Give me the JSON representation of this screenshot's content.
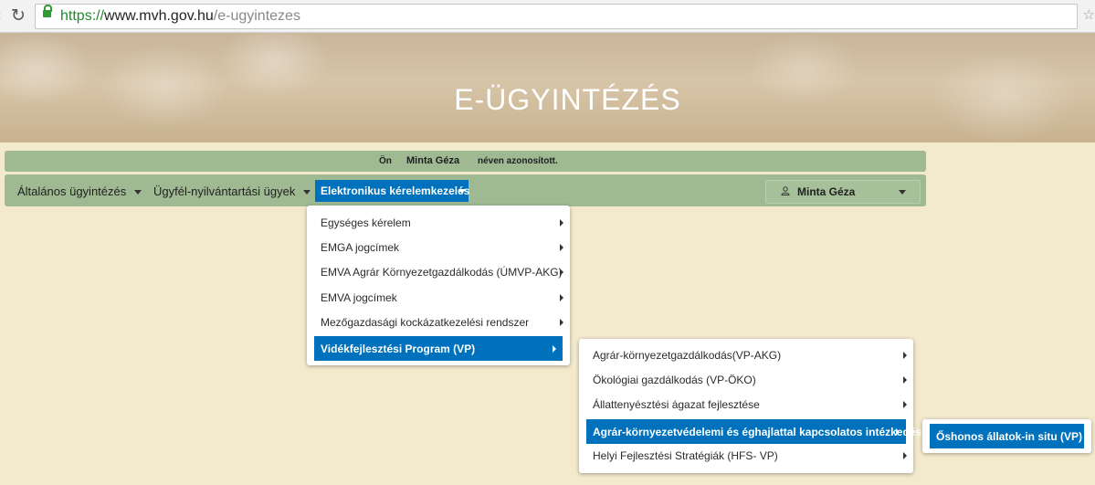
{
  "browser": {
    "url_scheme": "https://",
    "url_host": "www.mvh.gov.hu",
    "url_path": "/e-ugyintezes"
  },
  "header": {
    "title": "E-ÜGYINTÉZÉS"
  },
  "identification": {
    "prefix": "Ön",
    "user_name": "Minta Géza",
    "suffix": "néven azonosított."
  },
  "menubar": {
    "items": [
      {
        "label": "Általános ügyintézés"
      },
      {
        "label": "Ügyfél-nyilvántartási ügyek"
      },
      {
        "label": "Elektronikus kérelemkezelés"
      }
    ],
    "user": "Minta Géza"
  },
  "menu_level1": [
    {
      "label": "Egységes kérelem"
    },
    {
      "label": "EMGA jogcímek"
    },
    {
      "label": "EMVA Agrár Környezetgazdálkodás (ÚMVP-AKG)"
    },
    {
      "label": "EMVA jogcímek"
    },
    {
      "label": "Mezőgazdasági kockázatkezelési rendszer"
    },
    {
      "label": "Vidékfejlesztési Program (VP)"
    }
  ],
  "menu_level2": [
    {
      "label": "Agrár-környezetgazdálkodás(VP-AKG)"
    },
    {
      "label": "Ökológiai gazdálkodás (VP-ÖKO)"
    },
    {
      "label": "Állattenyésztési ágazat fejlesztése"
    },
    {
      "label": "Agrár-környezetvédelemi és éghajlattal kapcsolatos intézkedések"
    },
    {
      "label": "Helyi Fejlesztési Stratégiák (HFS- VP)"
    }
  ],
  "menu_level3": [
    {
      "label": "Őshonos állatok-in situ (VP)"
    }
  ],
  "colors": {
    "accent": "#0071bc",
    "bar_green": "#9fba92",
    "page_bg": "#f3e9cd"
  }
}
